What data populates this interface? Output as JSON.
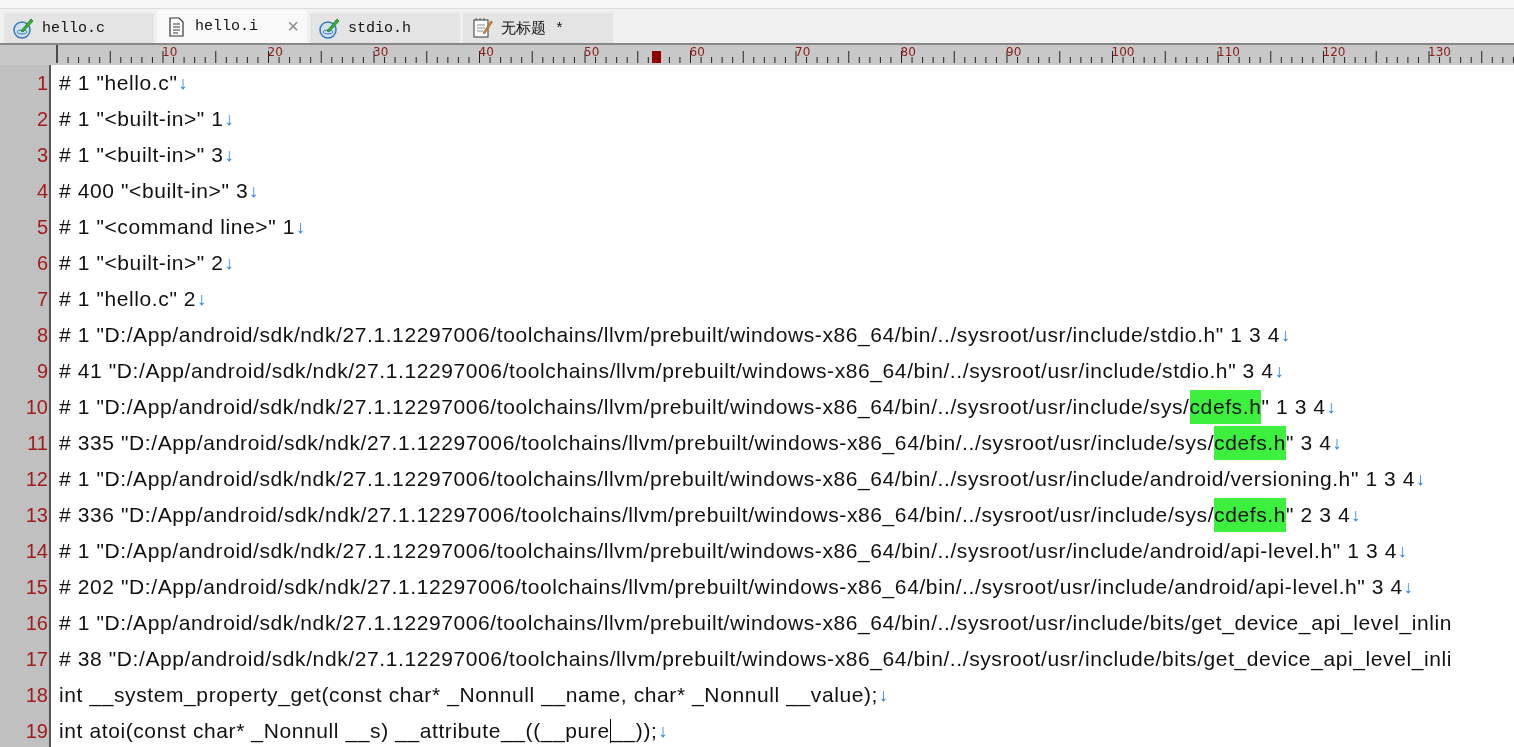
{
  "tabs": [
    {
      "label": "hello.c",
      "selected": false,
      "kind": "source",
      "close": false
    },
    {
      "label": "hello.i",
      "selected": true,
      "kind": "document",
      "close": true,
      "close_label": "×"
    },
    {
      "label": "stdio.h",
      "selected": false,
      "kind": "source",
      "close": false
    },
    {
      "label": "无标题 *",
      "selected": false,
      "kind": "notepad",
      "close": false
    }
  ],
  "ruler": {
    "labels": [
      "10",
      "20",
      "30",
      "40",
      "50",
      "60",
      "70",
      "80",
      "90",
      "100",
      "110",
      "120",
      "130"
    ]
  },
  "editor": {
    "lines": [
      {
        "number": "1",
        "eol": true,
        "parts": [
          {
            "kind": "plain",
            "text": "# 1 \"hello.c\""
          }
        ]
      },
      {
        "number": "2",
        "eol": true,
        "parts": [
          {
            "kind": "plain",
            "text": "# 1 \"<built-in>\" 1"
          }
        ]
      },
      {
        "number": "3",
        "eol": true,
        "parts": [
          {
            "kind": "plain",
            "text": "# 1 \"<built-in>\" 3"
          }
        ]
      },
      {
        "number": "4",
        "eol": true,
        "parts": [
          {
            "kind": "plain",
            "text": "# 400 \"<built-in>\" 3"
          }
        ]
      },
      {
        "number": "5",
        "eol": true,
        "parts": [
          {
            "kind": "plain",
            "text": "# 1 \"<command line>\" 1"
          }
        ]
      },
      {
        "number": "6",
        "eol": true,
        "parts": [
          {
            "kind": "plain",
            "text": "# 1 \"<built-in>\" 2"
          }
        ]
      },
      {
        "number": "7",
        "eol": true,
        "parts": [
          {
            "kind": "plain",
            "text": "# 1 \"hello.c\" 2"
          }
        ]
      },
      {
        "number": "8",
        "eol": true,
        "parts": [
          {
            "kind": "plain",
            "text": "# 1 \"D:/App/android/sdk/ndk/27.1.12297006/toolchains/llvm/prebuilt/windows-x86_64/bin/../sysroot/usr/include/stdio.h\" 1 3 4"
          }
        ]
      },
      {
        "number": "9",
        "eol": true,
        "parts": [
          {
            "kind": "plain",
            "text": "# 41 \"D:/App/android/sdk/ndk/27.1.12297006/toolchains/llvm/prebuilt/windows-x86_64/bin/../sysroot/usr/include/stdio.h\" 3 4"
          }
        ]
      },
      {
        "number": "10",
        "eol": true,
        "parts": [
          {
            "kind": "plain",
            "text": "# 1 \"D:/App/android/sdk/ndk/27.1.12297006/toolchains/llvm/prebuilt/windows-x86_64/bin/../sysroot/usr/include/sys/"
          },
          {
            "kind": "match",
            "text": "cdefs.h"
          },
          {
            "kind": "plain",
            "text": "\" 1 3 4"
          }
        ]
      },
      {
        "number": "11",
        "eol": true,
        "parts": [
          {
            "kind": "plain",
            "text": "# 335 \"D:/App/android/sdk/ndk/27.1.12297006/toolchains/llvm/prebuilt/windows-x86_64/bin/../sysroot/usr/include/sys/"
          },
          {
            "kind": "match",
            "text": "cdefs.h"
          },
          {
            "kind": "plain",
            "text": "\" 3 4"
          }
        ]
      },
      {
        "number": "12",
        "eol": true,
        "parts": [
          {
            "kind": "plain",
            "text": "# 1 \"D:/App/android/sdk/ndk/27.1.12297006/toolchains/llvm/prebuilt/windows-x86_64/bin/../sysroot/usr/include/android/versioning.h\" 1 3 4"
          }
        ]
      },
      {
        "number": "13",
        "eol": true,
        "parts": [
          {
            "kind": "plain",
            "text": "# 336 \"D:/App/android/sdk/ndk/27.1.12297006/toolchains/llvm/prebuilt/windows-x86_64/bin/../sysroot/usr/include/sys/"
          },
          {
            "kind": "match",
            "text": "cdefs.h"
          },
          {
            "kind": "plain",
            "text": "\" 2 3 4"
          }
        ]
      },
      {
        "number": "14",
        "eol": true,
        "parts": [
          {
            "kind": "plain",
            "text": "# 1 \"D:/App/android/sdk/ndk/27.1.12297006/toolchains/llvm/prebuilt/windows-x86_64/bin/../sysroot/usr/include/android/api-level.h\" 1 3 4"
          }
        ]
      },
      {
        "number": "15",
        "eol": true,
        "parts": [
          {
            "kind": "plain",
            "text": "# 202 \"D:/App/android/sdk/ndk/27.1.12297006/toolchains/llvm/prebuilt/windows-x86_64/bin/../sysroot/usr/include/android/api-level.h\" 3 4"
          }
        ]
      },
      {
        "number": "16",
        "eol": false,
        "parts": [
          {
            "kind": "plain",
            "text": "# 1 \"D:/App/android/sdk/ndk/27.1.12297006/toolchains/llvm/prebuilt/windows-x86_64/bin/../sysroot/usr/include/bits/get_device_api_level_inlin"
          }
        ]
      },
      {
        "number": "17",
        "eol": false,
        "parts": [
          {
            "kind": "plain",
            "text": "# 38 \"D:/App/android/sdk/ndk/27.1.12297006/toolchains/llvm/prebuilt/windows-x86_64/bin/../sysroot/usr/include/bits/get_device_api_level_inli"
          }
        ]
      },
      {
        "number": "18",
        "eol": true,
        "parts": [
          {
            "kind": "plain",
            "text": "int __system_property_get(const char* _Nonnull __name, char* _Nonnull __value);"
          }
        ]
      },
      {
        "number": "19",
        "eol": true,
        "parts": [
          {
            "kind": "plain",
            "text": "int atoi(const char* _Nonnull __s) __attribute__((__pure"
          },
          {
            "kind": "caret"
          },
          {
            "kind": "plain",
            "text": "__));"
          }
        ]
      }
    ],
    "eol_mark": "↓"
  }
}
